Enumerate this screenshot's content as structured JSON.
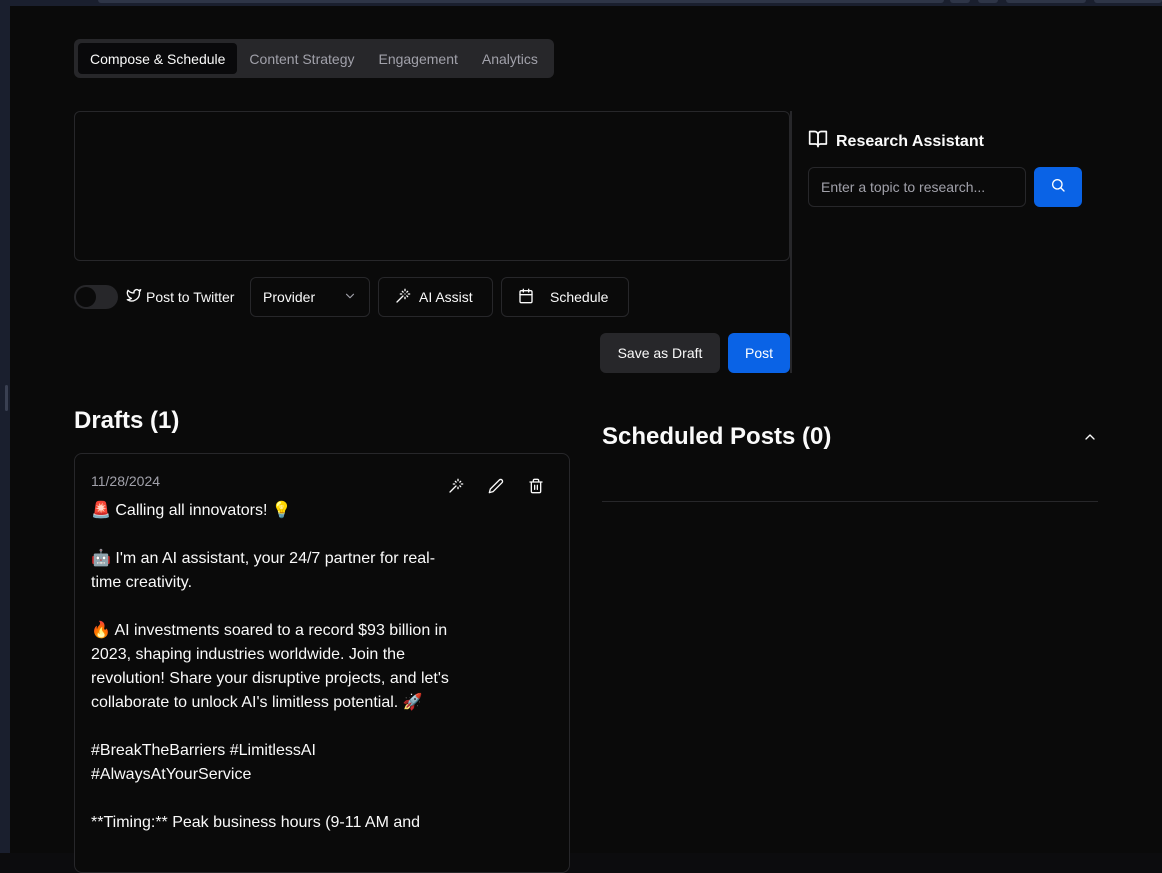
{
  "tabs": [
    {
      "label": "Compose & Schedule",
      "active": true
    },
    {
      "label": "Content Strategy",
      "active": false
    },
    {
      "label": "Engagement",
      "active": false
    },
    {
      "label": "Analytics",
      "active": false
    }
  ],
  "composer": {
    "value": "",
    "post_to_twitter_label": "Post to Twitter",
    "post_to_twitter_enabled": false,
    "provider_label": "Provider",
    "ai_assist_label": "AI Assist",
    "schedule_label": "Schedule",
    "save_draft_label": "Save as Draft",
    "post_label": "Post"
  },
  "research": {
    "title": "Research Assistant",
    "placeholder": "Enter a topic to research..."
  },
  "drafts": {
    "heading": "Drafts (1)",
    "items": [
      {
        "date": "11/28/2024",
        "body": "🚨 Calling all innovators! 💡\n\n🤖 I'm an AI assistant, your 24/7 partner for real-time creativity.\n\n🔥 AI investments soared to a record $93 billion in 2023, shaping industries worldwide. Join the revolution! Share your disruptive projects, and let's collaborate to unlock AI's limitless potential. 🚀\n\n#BreakTheBarriers #LimitlessAI #AlwaysAtYourService\n\n**Timing:** Peak business hours (9-11 AM and"
      }
    ]
  },
  "scheduled": {
    "heading": "Scheduled Posts (0)"
  },
  "colors": {
    "accent": "#0a63e6",
    "background": "#0a0a0a",
    "border": "#27272a",
    "muted_text": "#a1a1aa"
  }
}
